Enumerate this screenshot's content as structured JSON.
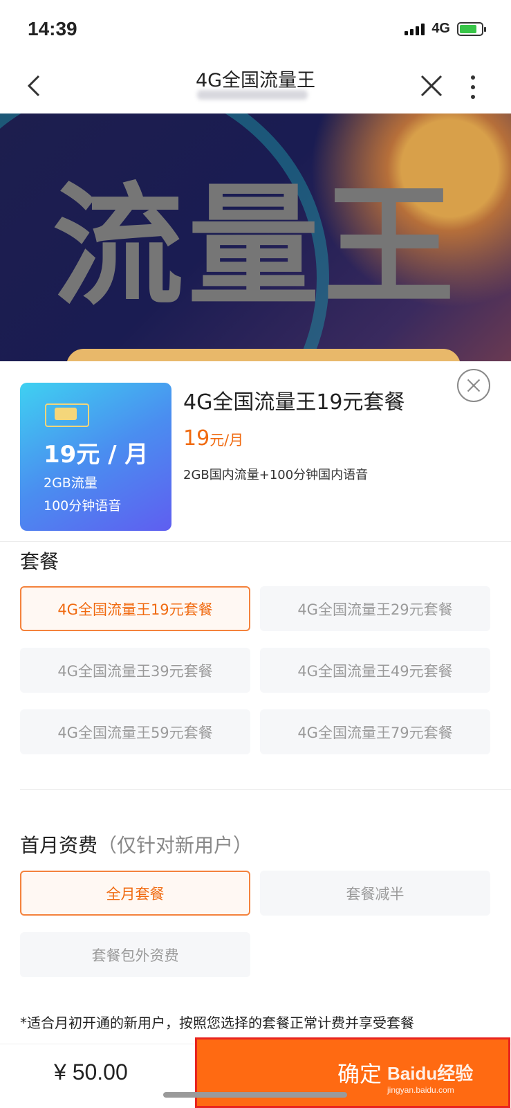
{
  "status_bar": {
    "time": "14:39",
    "network": "4G"
  },
  "nav": {
    "title": "4G全国流量王"
  },
  "banner": {
    "title": "流量王"
  },
  "product": {
    "thumb_price": "19元 / 月",
    "thumb_line1": "2GB流量",
    "thumb_line2": "100分钟语音",
    "title": "4G全国流量王19元套餐",
    "price_number": "19",
    "price_unit": "元/月",
    "description": "2GB国内流量+100分钟国内语音"
  },
  "plans": {
    "label": "套餐",
    "options": [
      "4G全国流量王19元套餐",
      "4G全国流量王29元套餐",
      "4G全国流量王39元套餐",
      "4G全国流量王49元套餐",
      "4G全国流量王59元套餐",
      "4G全国流量王79元套餐"
    ],
    "selected_index": 0
  },
  "first_month": {
    "label": "首月资费",
    "hint": "（仅针对新用户）",
    "options": [
      "全月套餐",
      "套餐减半",
      "套餐包外资费"
    ],
    "selected_index": 0
  },
  "footnote": "*适合月初开通的新用户，按照您选择的套餐正常计费并享受套餐",
  "bottom": {
    "total": "¥ 50.00",
    "confirm_label": "确定"
  },
  "watermark": {
    "brand": "Baidu经验",
    "url": "jingyan.baidu.com"
  },
  "colors": {
    "accent": "#f06a10",
    "confirm_bg": "#ff6a12"
  }
}
